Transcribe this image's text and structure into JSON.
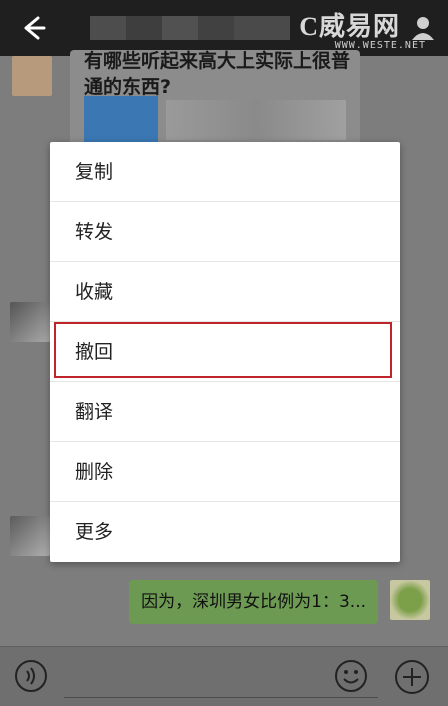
{
  "header": {
    "back_icon": "back-arrow-icon",
    "watermark": "C威易网",
    "watermark_sub": "WWW.WESTE.NET",
    "profile_icon": "person-icon"
  },
  "chat": {
    "incoming_text": "有哪些听起来高大上实际上很普通的东西?",
    "outgoing_text": "因为，深圳男女比例为1：3..."
  },
  "menu": {
    "items": [
      "复制",
      "转发",
      "收藏",
      "撤回",
      "翻译",
      "删除",
      "更多"
    ],
    "highlight_color": "#c0242b"
  },
  "bottom": {
    "voice_icon": "voice-icon",
    "emoji_icon": "emoji-icon",
    "plus_icon": "plus-icon"
  },
  "colors": {
    "topbar": "#1f1f1f",
    "outgoing_bubble": "#6d9a52"
  }
}
